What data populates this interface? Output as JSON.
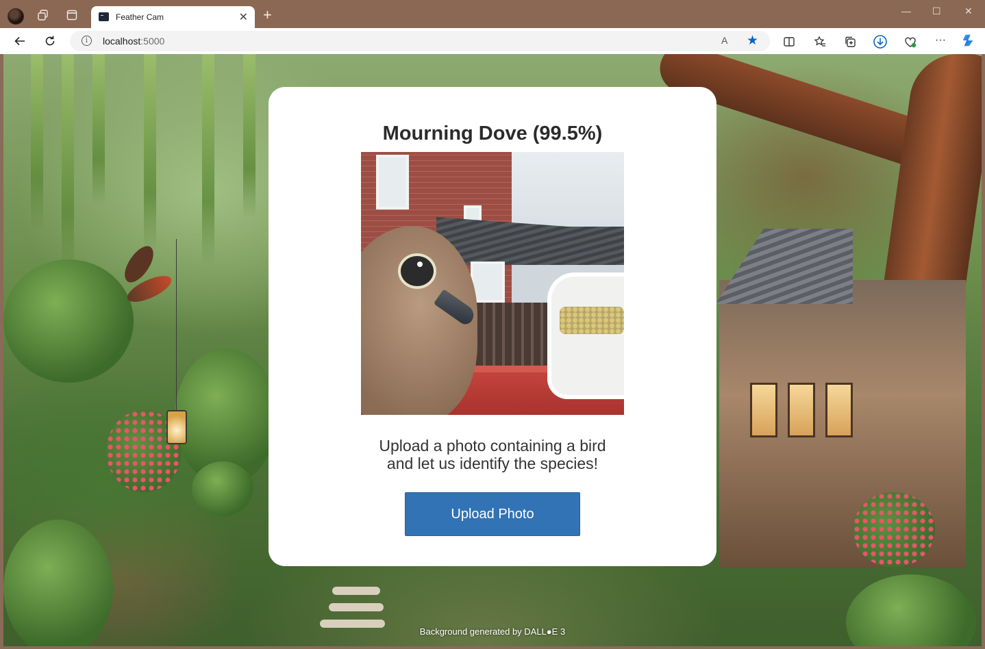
{
  "browser": {
    "tab": {
      "title": "Feather Cam"
    },
    "address": {
      "host": "localhost",
      "port": ":5000"
    },
    "icons": {
      "profile": "profile-avatar",
      "workspaces": "workspaces-icon",
      "tab_actions": "tab-actions-icon",
      "back": "back-arrow-icon",
      "refresh": "refresh-icon",
      "info": "site-info-icon",
      "read_aloud": "read-aloud-icon",
      "favorite": "star-icon",
      "split_screen": "split-screen-icon",
      "favorites": "favorites-icon",
      "collections": "collections-icon",
      "downloads": "download-icon",
      "browser_essentials": "browser-essentials-icon",
      "more": "more-icon",
      "copilot": "copilot-icon"
    },
    "glyphs": {
      "tab_close": "✕",
      "new_tab": "+",
      "minimize": "—",
      "maximize": "☐",
      "close": "✕",
      "info": "i",
      "read_aloud": "A",
      "favorite": "★",
      "more": "···"
    },
    "accent_color": "#0a64c8"
  },
  "page": {
    "result_title": "Mourning Dove (99.5%)",
    "upload_text_line1": "Upload a photo containing a bird",
    "upload_text_line2": "and let us identify the species!",
    "upload_button_label": "Upload Photo",
    "background_credit": "Background generated by DALL●E 3",
    "button_color": "#3273b5"
  }
}
